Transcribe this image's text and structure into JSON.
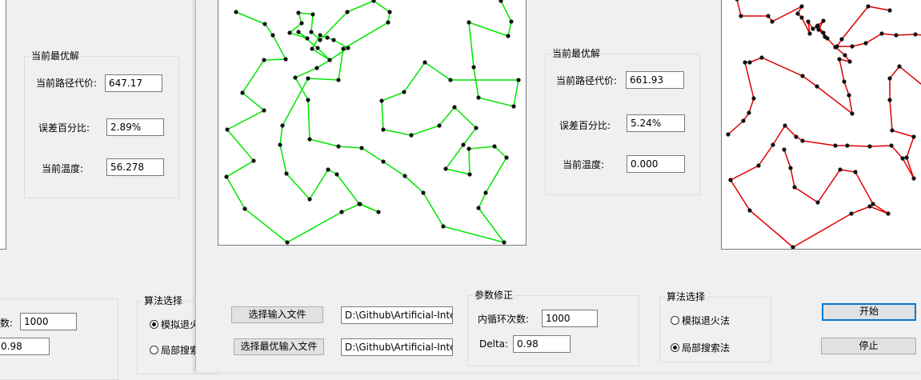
{
  "colors": {
    "route_front": "#00e600",
    "route_back": "#e00000",
    "city": "#111111",
    "accent": "#0078d7"
  },
  "back_window": {
    "best": {
      "group_title": "当前最优解",
      "cost_label": "当前路径代价:",
      "cost_value": "647.17",
      "error_label": "误差百分比:",
      "error_value": "2.89%",
      "temp_label": "当前温度:",
      "temp_value": "56.278"
    },
    "params": {
      "iter_label_partial": "数:",
      "iter_value": "1000",
      "delta_value": "0.98"
    },
    "algo": {
      "group_title": "算法选择",
      "sa_label": "模拟退火法",
      "ls_label": "局部搜索法",
      "sa_selected": true,
      "ls_selected": false
    }
  },
  "front_window": {
    "best": {
      "group_title": "当前最优解",
      "cost_label": "当前路径代价:",
      "cost_value": "661.93",
      "error_label": "误差百分比:",
      "error_value": "5.24%",
      "temp_label": "当前温度:",
      "temp_value": "0.000"
    },
    "files": {
      "select_input_button": "选择输入文件",
      "input_path": "D:\\Github\\Artificial-Intelli",
      "select_best_button": "选择最优输入文件",
      "best_path": "D:\\Github\\Artificial-Intelli"
    },
    "params": {
      "group_title": "参数修正",
      "iter_label": "内循环次数:",
      "iter_value": "1000",
      "delta_label": "Delta:",
      "delta_value": "0.98"
    },
    "algo": {
      "group_title": "算法选择",
      "sa_label": "模拟退火法",
      "ls_label": "局部搜索法",
      "sa_selected": false,
      "ls_selected": true
    },
    "start_button": "开始",
    "stop_button": "停止"
  }
}
